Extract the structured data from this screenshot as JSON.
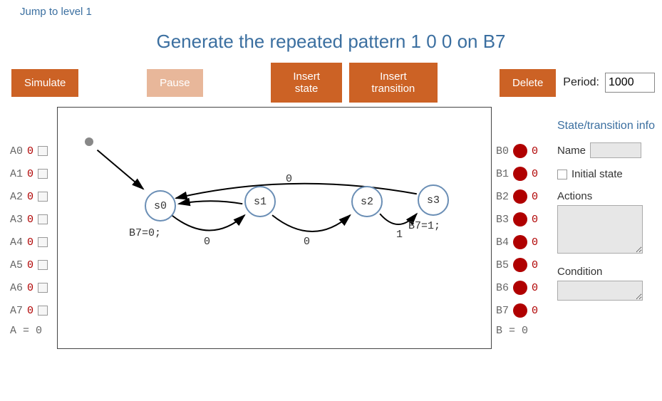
{
  "link_top": "Jump to level 1",
  "title": "Generate the repeated pattern 1 0 0 on B7",
  "toolbar": {
    "simulate": "Simulate",
    "pause": "Pause",
    "insert_state": "Insert state",
    "insert_transition": "Insert transition",
    "delete": "Delete",
    "period_label": "Period:",
    "period_value": "1000"
  },
  "inputs_a": [
    {
      "name": "A0",
      "value": "0"
    },
    {
      "name": "A1",
      "value": "0"
    },
    {
      "name": "A2",
      "value": "0"
    },
    {
      "name": "A3",
      "value": "0"
    },
    {
      "name": "A4",
      "value": "0"
    },
    {
      "name": "A5",
      "value": "0"
    },
    {
      "name": "A6",
      "value": "0"
    },
    {
      "name": "A7",
      "value": "0"
    }
  ],
  "inputs_a_sum": "A = 0",
  "outputs_b": [
    {
      "name": "B0",
      "value": "0"
    },
    {
      "name": "B1",
      "value": "0"
    },
    {
      "name": "B2",
      "value": "0"
    },
    {
      "name": "B3",
      "value": "0"
    },
    {
      "name": "B4",
      "value": "0"
    },
    {
      "name": "B5",
      "value": "0"
    },
    {
      "name": "B6",
      "value": "0"
    },
    {
      "name": "B7",
      "value": "0"
    }
  ],
  "outputs_b_sum": "B = 0",
  "states": {
    "s0": "s0",
    "s1": "s1",
    "s2": "s2",
    "s3": "s3"
  },
  "state_actions": {
    "s0": "B7=0;",
    "s3": "B7=1;"
  },
  "edges": {
    "s0_s1": "0",
    "s1_s2": "0",
    "s2_s3": "1",
    "s3_s0": "0"
  },
  "panel": {
    "header": "State/transition info",
    "name_label": "Name",
    "initial_label": "Initial state",
    "actions_label": "Actions",
    "condition_label": "Condition"
  }
}
